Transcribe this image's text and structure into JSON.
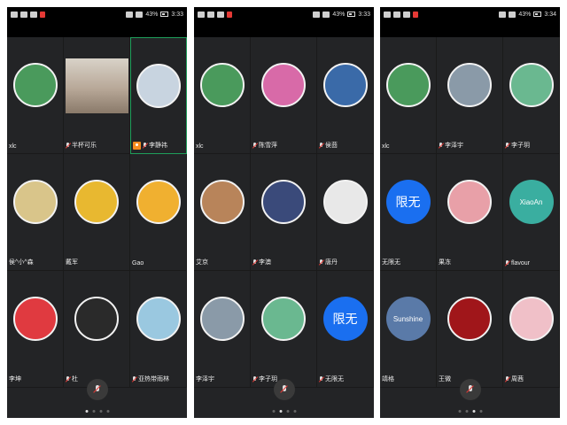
{
  "screens": [
    {
      "status": {
        "battery": "43%",
        "time": "3:33"
      },
      "page_index": 0,
      "tiles": [
        {
          "name": "xlc",
          "mic": false,
          "host": false,
          "avatar": "waterfall-icon",
          "color": "#4a9a5c"
        },
        {
          "name": "半杯可乐",
          "mic": true,
          "host": false,
          "avatar": "video-feed",
          "color": "#8a7a6a",
          "video": true
        },
        {
          "name": "李静祎",
          "mic": true,
          "host": true,
          "avatar": "masked-girl-icon",
          "color": "#c8d4e0",
          "active": true
        },
        {
          "name": "侯^小^森",
          "mic": false,
          "host": false,
          "avatar": "cartoon-rhino-icon",
          "color": "#d9c58a"
        },
        {
          "name": "戴军",
          "mic": false,
          "host": false,
          "avatar": "cartoon-cat-icon",
          "color": "#e8b830"
        },
        {
          "name": "Gao",
          "mic": false,
          "host": false,
          "avatar": "cartoon-boy-icon",
          "color": "#f0b030"
        },
        {
          "name": "李坤",
          "mic": false,
          "host": false,
          "avatar": "cartoon-girl-icon",
          "color": "#e03a40"
        },
        {
          "name": "杜",
          "mic": true,
          "host": false,
          "avatar": "man-photo-icon",
          "color": "#2a2a2a"
        },
        {
          "name": "亚热带雨林",
          "mic": true,
          "host": false,
          "avatar": "anime-boy-icon",
          "color": "#9ac8e0"
        }
      ]
    },
    {
      "status": {
        "battery": "43%",
        "time": "3:33"
      },
      "page_index": 1,
      "tiles": [
        {
          "name": "xlc",
          "mic": false,
          "host": false,
          "avatar": "waterfall-icon",
          "color": "#4a9a5c"
        },
        {
          "name": "陈雪萍",
          "mic": true,
          "host": false,
          "avatar": "cartoon-character-icon",
          "color": "#d86aa8"
        },
        {
          "name": "侯茴",
          "mic": true,
          "host": false,
          "avatar": "blue-silhouette-icon",
          "color": "#3a6aa8"
        },
        {
          "name": "艾京",
          "mic": false,
          "host": false,
          "avatar": "person-landscape-icon",
          "color": "#b8845a"
        },
        {
          "name": "李澳",
          "mic": true,
          "host": false,
          "avatar": "night-sky-icon",
          "color": "#3a4a7a"
        },
        {
          "name": "唐丹",
          "mic": true,
          "host": false,
          "avatar": "black-cat-icon",
          "color": "#e8e8e8"
        },
        {
          "name": "李泽宇",
          "mic": false,
          "host": false,
          "avatar": "person-landscape-icon",
          "color": "#8a9aa8"
        },
        {
          "name": "李子玥",
          "mic": true,
          "host": false,
          "avatar": "cartoon-crocodile-icon",
          "color": "#6ab890"
        },
        {
          "name": "无限无",
          "mic": true,
          "host": false,
          "avatar": "text-avatar",
          "color": "#1a6ff0",
          "text": "限无"
        }
      ]
    },
    {
      "status": {
        "battery": "43%",
        "time": "3:34"
      },
      "page_index": 2,
      "tiles": [
        {
          "name": "xlc",
          "mic": false,
          "host": false,
          "avatar": "waterfall-icon",
          "color": "#4a9a5c"
        },
        {
          "name": "李泽宇",
          "mic": true,
          "host": false,
          "avatar": "person-landscape-icon",
          "color": "#8a9aa8"
        },
        {
          "name": "李子玥",
          "mic": true,
          "host": false,
          "avatar": "cartoon-crocodile-icon",
          "color": "#6ab890"
        },
        {
          "name": "无限无",
          "mic": false,
          "host": false,
          "avatar": "text-avatar",
          "color": "#1a6ff0",
          "text": "限无"
        },
        {
          "name": "果冻",
          "mic": false,
          "host": false,
          "avatar": "cartoon-girl-icon",
          "color": "#e8a0a8"
        },
        {
          "name": "flavour",
          "mic": true,
          "host": false,
          "avatar": "text-avatar",
          "color": "#3aaea0",
          "text": "XiaoAn"
        },
        {
          "name": "靖格",
          "mic": false,
          "host": false,
          "avatar": "sunshine-icon",
          "color": "#5a7aa8",
          "text": "Sunshine"
        },
        {
          "name": "王微",
          "mic": false,
          "host": false,
          "avatar": "red-circle-icon",
          "color": "#a0161a"
        },
        {
          "name": "周茜",
          "mic": true,
          "host": false,
          "avatar": "pig-icon",
          "color": "#f0c0c8"
        }
      ]
    }
  ]
}
